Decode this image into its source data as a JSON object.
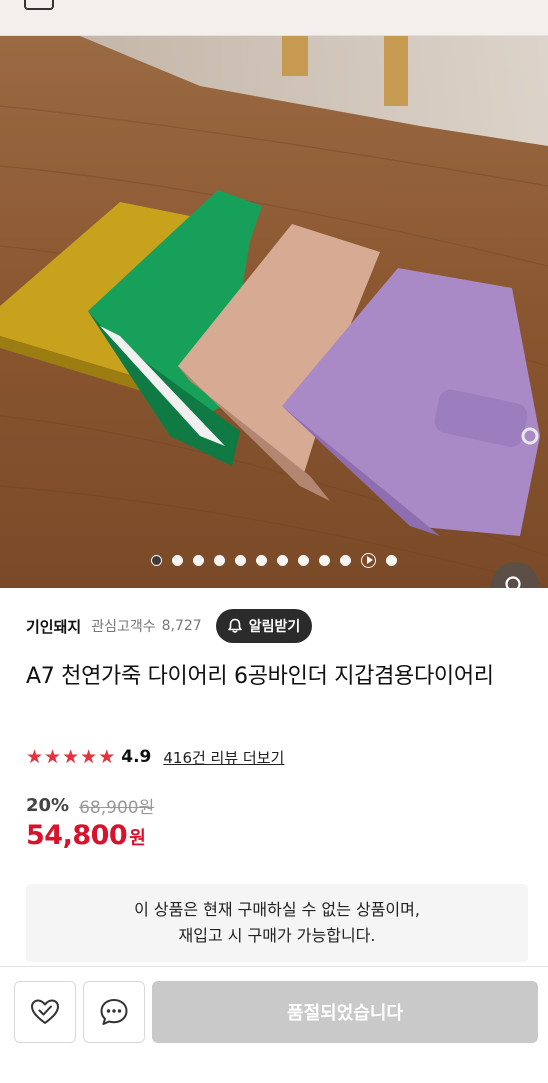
{
  "product": {
    "seller": "기인돼지",
    "favorite_label": "관심고객수",
    "favorite_count": "8,727",
    "alarm_label": "알림받기",
    "title": "A7 천연가죽 다이어리 6공바인더 지갑겸용다이어리",
    "rating": "4.9",
    "rating_stars": 5,
    "review_link": "416건 리뷰 더보기",
    "discount": "20%",
    "original_price": "68,900원",
    "sale_price": "54,800",
    "currency": "원"
  },
  "gallery": {
    "slide_count": 12,
    "active_index": 0,
    "play_index": 10,
    "zoom_icon": "magnifier-icon"
  },
  "notice": {
    "line1": "이 상품은 현재 구매하실 수 없는 상품이며,",
    "line2": "재입고 시 구매가 가능합니다."
  },
  "bottom_bar": {
    "wish_icon": "heart-check-icon",
    "chat_icon": "chat-bubble-icon",
    "soldout_label": "품절되었습니다"
  },
  "colors": {
    "accent_red": "#d8112c",
    "star_red": "#e8313a",
    "dark_button": "#2b2b2b",
    "disabled_button": "#c9c9c9"
  }
}
